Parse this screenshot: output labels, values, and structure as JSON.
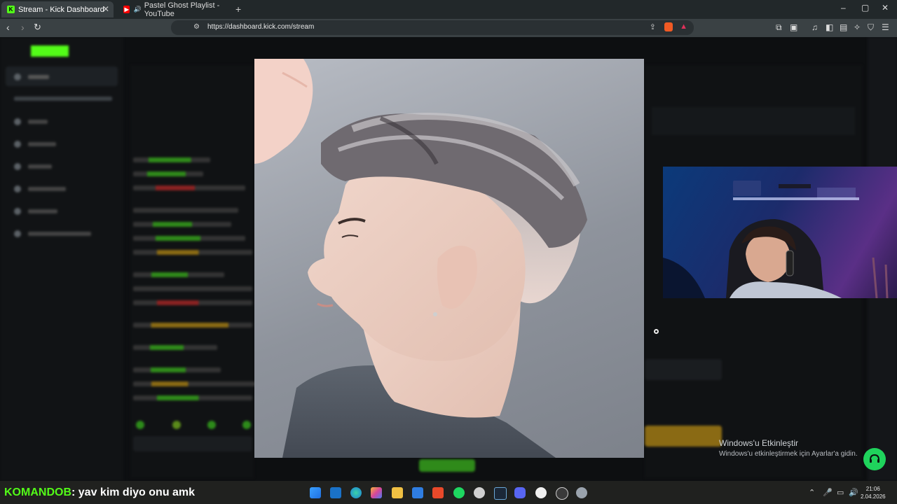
{
  "browser": {
    "tabs": [
      {
        "label": "Stream - Kick Dashboard",
        "active": true,
        "favicon": "kick-icon"
      },
      {
        "label": "Pastel Ghost Playlist - YouTube",
        "active": false,
        "favicon": "youtube-icon"
      }
    ],
    "url": "https://dashboard.kick.com/stream",
    "new_tab": "+",
    "window_controls": [
      "–",
      "▢",
      "✕"
    ]
  },
  "dashboard": {
    "accent_color": "#53fc18",
    "blurred": true
  },
  "overlay": {
    "type": "photo",
    "subject": "man-side-profile-fade-haircut"
  },
  "webcam": {
    "type": "streamer-webcam"
  },
  "watermark": {
    "title": "Windows'u Etkinleştir",
    "subtitle": "Windows'u etkinleştirmek için Ayarlar'a gidin."
  },
  "chat_message": {
    "user": "KOMANDOB",
    "text": ": yav kim diyo onu amk"
  },
  "taskbar": {
    "time": "21:06",
    "date": "2.04.2026",
    "apps": [
      "windows-start-icon",
      "mail-icon",
      "edge-icon",
      "copilot-icon",
      "folder-icon",
      "store-icon",
      "brave-icon",
      "spotify-icon",
      "settings-gear-icon",
      "steam-icon",
      "discord-icon",
      "obs-icon",
      "chatgpt-icon",
      "gear-icon"
    ]
  }
}
